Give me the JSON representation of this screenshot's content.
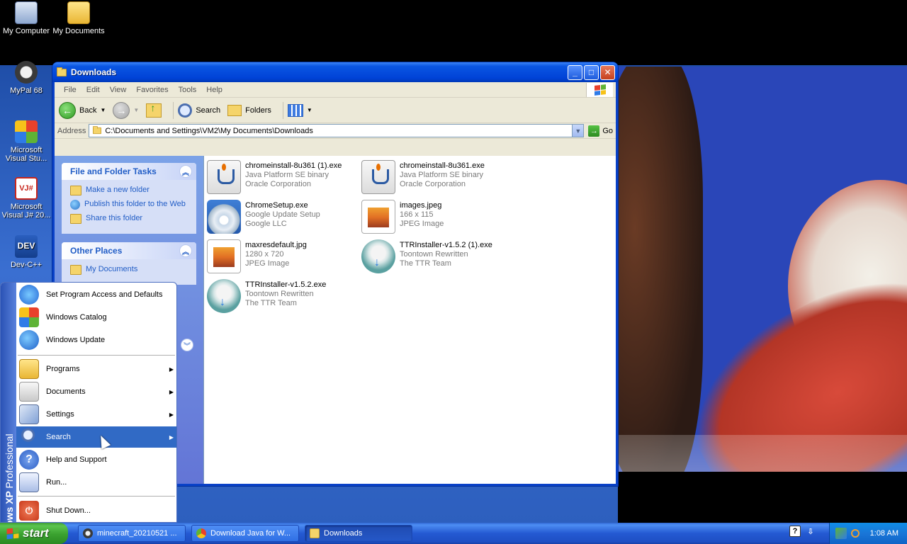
{
  "desktop": {
    "icons": [
      {
        "label": "My Computer",
        "icon": "my-computer-icon"
      },
      {
        "label": "My Documents",
        "icon": "my-documents-icon"
      },
      {
        "label": "MyPal 68",
        "icon": "mypal-icon"
      },
      {
        "label": "Microsoft Visual Stu...",
        "icon": "visual-studio-icon"
      },
      {
        "label": "Microsoft Visual J# 20...",
        "icon": "visual-jsharp-icon"
      },
      {
        "label": "Dev-C++",
        "icon": "devcpp-icon"
      }
    ]
  },
  "window": {
    "title": "Downloads",
    "menu": [
      "File",
      "Edit",
      "View",
      "Favorites",
      "Tools",
      "Help"
    ],
    "toolbar": {
      "back": "Back",
      "search": "Search",
      "folders": "Folders"
    },
    "address": {
      "label": "Address",
      "value": "C:\\Documents and Settings\\VM2\\My Documents\\Downloads",
      "go": "Go"
    },
    "taskpane": {
      "file_tasks": {
        "title": "File and Folder Tasks",
        "items": [
          "Make a new folder",
          "Publish this folder to the Web",
          "Share this folder"
        ]
      },
      "other_places": {
        "title": "Other Places",
        "items": [
          "My Documents"
        ]
      }
    },
    "files": [
      {
        "name": "chromeinstall-8u361 (1).exe",
        "line2": "Java Platform SE binary",
        "line3": "Oracle Corporation",
        "icon": "java-icon"
      },
      {
        "name": "chromeinstall-8u361.exe",
        "line2": "Java Platform SE binary",
        "line3": "Oracle Corporation",
        "icon": "java-icon"
      },
      {
        "name": "ChromeSetup.exe",
        "line2": "Google Update Setup",
        "line3": "Google LLC",
        "icon": "setup-cd-icon"
      },
      {
        "name": "images.jpeg",
        "line2": "166 x 115",
        "line3": "JPEG Image",
        "icon": "jpeg-icon"
      },
      {
        "name": "maxresdefault.jpg",
        "line2": "1280 x 720",
        "line3": "JPEG Image",
        "icon": "jpeg-icon"
      },
      {
        "name": "TTRInstaller-v1.5.2 (1).exe",
        "line2": "Toontown Rewritten",
        "line3": "The TTR Team",
        "icon": "ttr-installer-icon"
      },
      {
        "name": "TTRInstaller-v1.5.2.exe",
        "line2": "Toontown Rewritten",
        "line3": "The TTR Team",
        "icon": "ttr-installer-icon"
      }
    ]
  },
  "start_menu": {
    "band": {
      "brand": "Windows XP",
      "edition": "Professional"
    },
    "top_items": [
      "Set Program Access and Defaults",
      "Windows Catalog",
      "Windows Update"
    ],
    "items": [
      {
        "label": "Programs",
        "submenu": true
      },
      {
        "label": "Documents",
        "submenu": true
      },
      {
        "label": "Settings",
        "submenu": true
      },
      {
        "label": "Search",
        "submenu": true,
        "highlighted": true
      },
      {
        "label": "Help and Support",
        "submenu": false
      },
      {
        "label": "Run...",
        "submenu": false
      }
    ],
    "shutdown": "Shut Down..."
  },
  "taskbar": {
    "start": "start",
    "tasks": [
      {
        "label": "minecraft_20210521 ...",
        "active": false
      },
      {
        "label": "Download Java for W...",
        "active": false
      },
      {
        "label": "Downloads",
        "active": true
      }
    ],
    "clock": "1:08 AM"
  },
  "colors": {
    "xp_blue": "#0042d6",
    "start_green": "#3aa12f",
    "link_blue": "#215dc6",
    "menu_highlight": "#316ac5"
  }
}
